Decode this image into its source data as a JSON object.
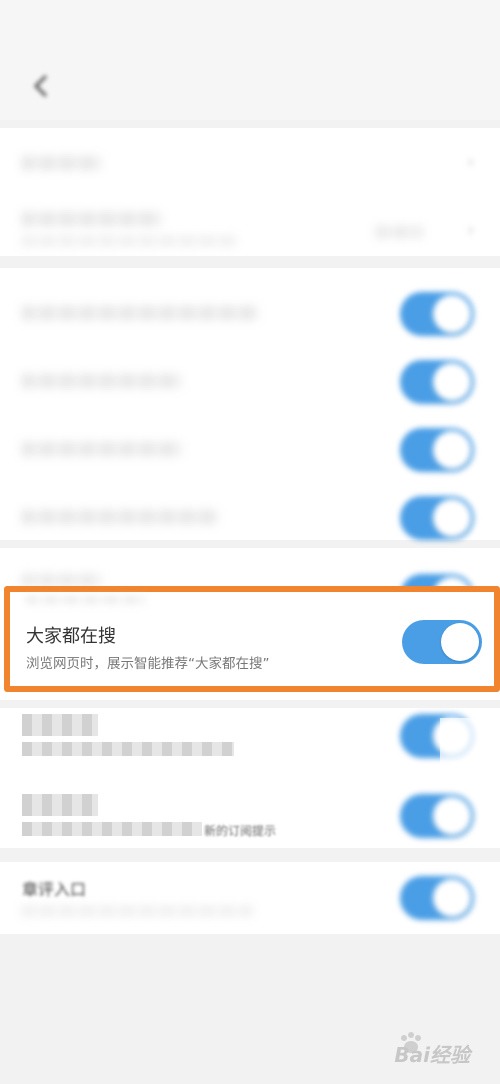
{
  "status_bar": {
    "left_text": "",
    "right_text": ""
  },
  "header": {
    "title": ""
  },
  "highlighted_setting": {
    "title": "大家都在搜",
    "description": "浏览网页时，展示智能推荐“大家都在搜”",
    "toggle_on": true
  },
  "partial_labels": {
    "row_10_fragment": "新的订阅提示",
    "row_11_label": "章评入口"
  },
  "watermark": {
    "text": "Bai经验"
  },
  "colors": {
    "accent": "#4a9ee6",
    "highlight_border": "#f0842f"
  }
}
